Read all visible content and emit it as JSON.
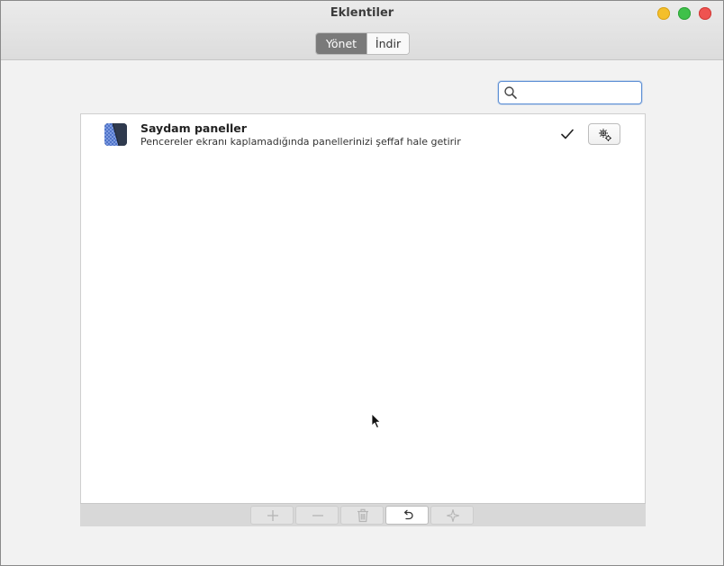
{
  "window": {
    "title": "Eklentiler"
  },
  "tabs": [
    {
      "label": "Yönet",
      "active": true
    },
    {
      "label": "İndir",
      "active": false
    }
  ],
  "search": {
    "value": "",
    "placeholder": ""
  },
  "extensions": [
    {
      "name": "Saydam paneller",
      "description": "Pencereler ekranı kaplamadığında panellerinizi şeffaf hale getirir",
      "enabled": true
    }
  ],
  "toolbar": {
    "buttons": [
      "plus-icon",
      "minus-icon",
      "trash-icon",
      "undo-icon",
      "star-icon"
    ]
  },
  "colors": {
    "accent": "#5d8fd5",
    "active_tab": "#7a7a7a",
    "close": "#ef5350",
    "minimize": "#f4bf2a",
    "maximize": "#3fc14a"
  }
}
